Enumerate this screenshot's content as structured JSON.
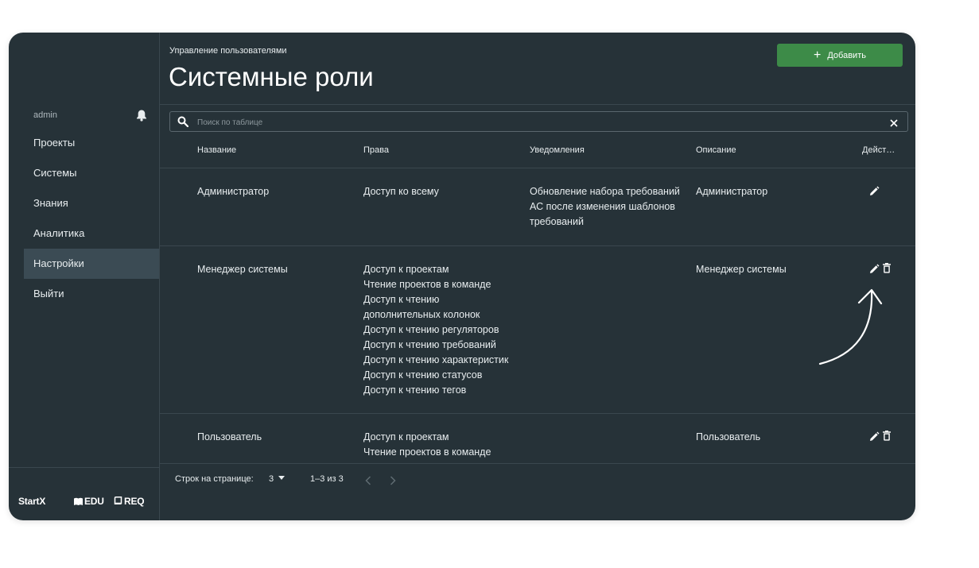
{
  "sidebar": {
    "user": "admin",
    "nav": [
      "Проекты",
      "Системы",
      "Знания",
      "Аналитика",
      "Настройки",
      "Выйти"
    ],
    "active_index": 4,
    "brands": [
      "StartX",
      "EDU",
      "REQ"
    ]
  },
  "header": {
    "breadcrumb": "Управление пользователями",
    "title": "Системные роли",
    "add_label": "Добавить"
  },
  "search": {
    "placeholder": "Поиск по таблице"
  },
  "table": {
    "columns": [
      "Название",
      "Права",
      "Уведомления",
      "Описание",
      "Дейст…"
    ],
    "rows": [
      {
        "name": "Администратор",
        "rights": [
          "Доступ ко всему"
        ],
        "notifications": [
          "Обновление набора требований",
          "АС после изменения шаблонов",
          "требований"
        ],
        "description": "Администратор",
        "can_delete": false
      },
      {
        "name": "Менеджер системы",
        "rights": [
          "Доступ к проектам",
          "Чтение проектов в команде",
          "Доступ к чтению",
          "дополнительных колонок",
          "Доступ к чтению регуляторов",
          "Доступ к чтению требований",
          "Доступ к чтению характеристик",
          "Доступ к чтению статусов",
          "Доступ к чтению тегов"
        ],
        "notifications": [],
        "description": "Менеджер системы",
        "can_delete": true
      },
      {
        "name": "Пользователь",
        "rights": [
          "Доступ к проектам",
          "Чтение проектов в команде"
        ],
        "notifications": [],
        "description": "Пользователь",
        "can_delete": true
      }
    ]
  },
  "pagination": {
    "rows_per_page_label": "Строк на странице:",
    "rows_per_page": "3",
    "range": "1–3 из 3"
  },
  "colors": {
    "background": "#263238",
    "active_nav": "#3b4b54",
    "accent": "#3d8b48",
    "text": "#e8edef"
  }
}
